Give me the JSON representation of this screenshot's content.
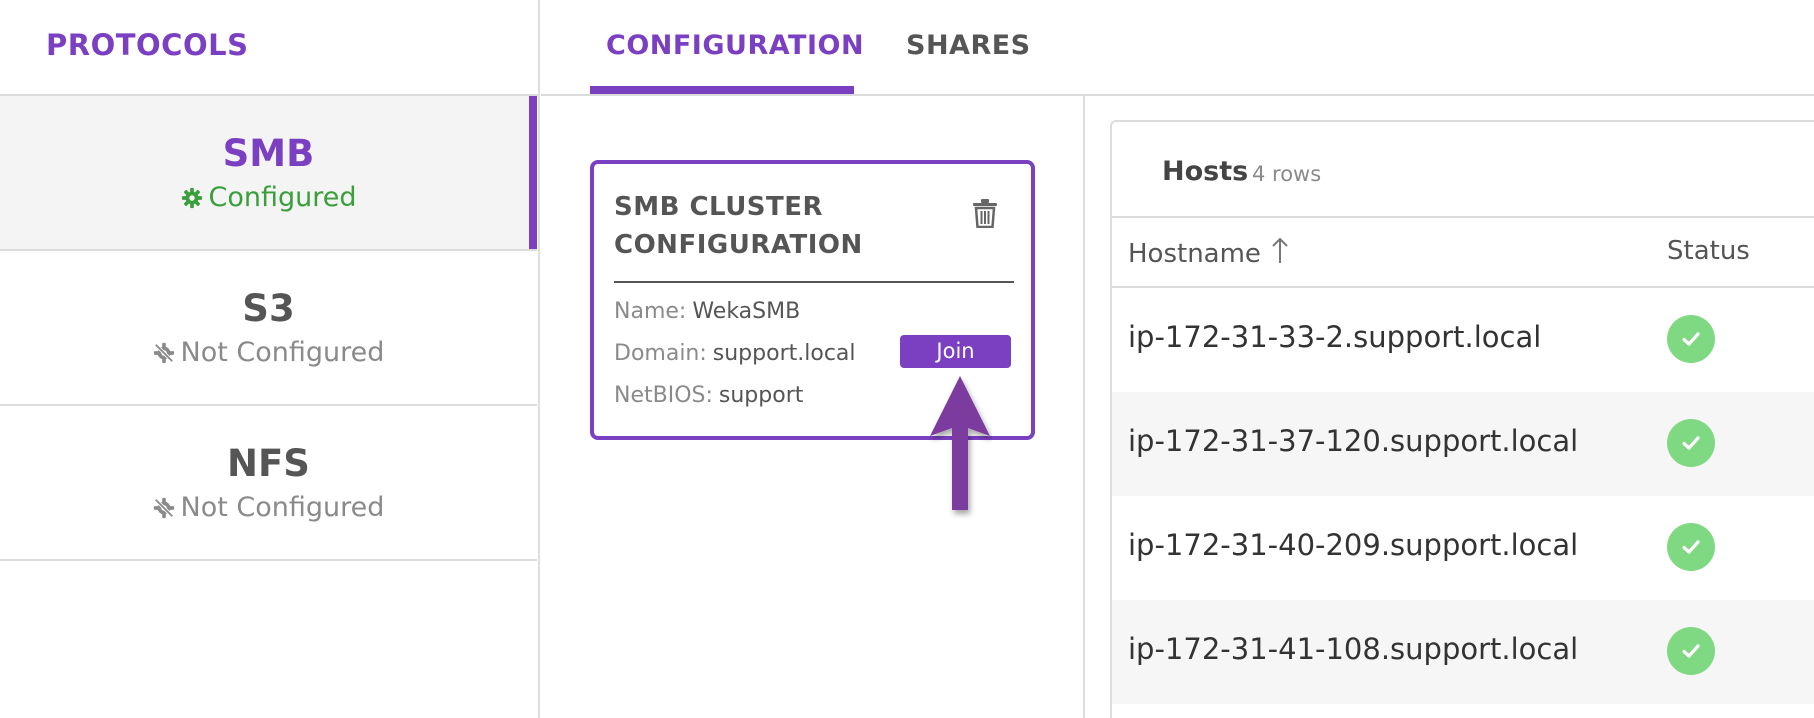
{
  "sidebar": {
    "title": "PROTOCOLS",
    "items": [
      {
        "name": "SMB",
        "status": "Configured",
        "status_icon": "gear-icon",
        "active": true
      },
      {
        "name": "S3",
        "status": "Not Configured",
        "status_icon": "disabled-gear-icon",
        "active": false
      },
      {
        "name": "NFS",
        "status": "Not Configured",
        "status_icon": "disabled-gear-icon",
        "active": false
      }
    ]
  },
  "tabs": [
    {
      "label": "CONFIGURATION",
      "active": true
    },
    {
      "label": "SHARES",
      "active": false
    }
  ],
  "smb_card": {
    "title_line1": "SMB CLUSTER",
    "title_line2": "CONFIGURATION",
    "delete_icon": "trash-icon",
    "name_label": "Name:",
    "name_value": "WekaSMB",
    "domain_label": "Domain:",
    "domain_value": "support.local",
    "netbios_label": "NetBIOS:",
    "netbios_value": "support",
    "join_label": "Join",
    "annotation_icon": "arrow-up-icon"
  },
  "hosts": {
    "title": "Hosts",
    "count_label": "4 rows",
    "columns": {
      "hostname": "Hostname",
      "status": "Status"
    },
    "sort_icon": "arrow-up-icon",
    "rows": [
      {
        "hostname": "ip-172-31-33-2.support.local",
        "status_icon": "check-circle-icon"
      },
      {
        "hostname": "ip-172-31-37-120.support.local",
        "status_icon": "check-circle-icon"
      },
      {
        "hostname": "ip-172-31-40-209.support.local",
        "status_icon": "check-circle-icon"
      },
      {
        "hostname": "ip-172-31-41-108.support.local",
        "status_icon": "check-circle-icon"
      }
    ]
  },
  "colors": {
    "accent": "#7b3fc2",
    "configured": "#3a9e3a",
    "status_ok": "#7fd882",
    "muted": "#8a8a8a"
  }
}
